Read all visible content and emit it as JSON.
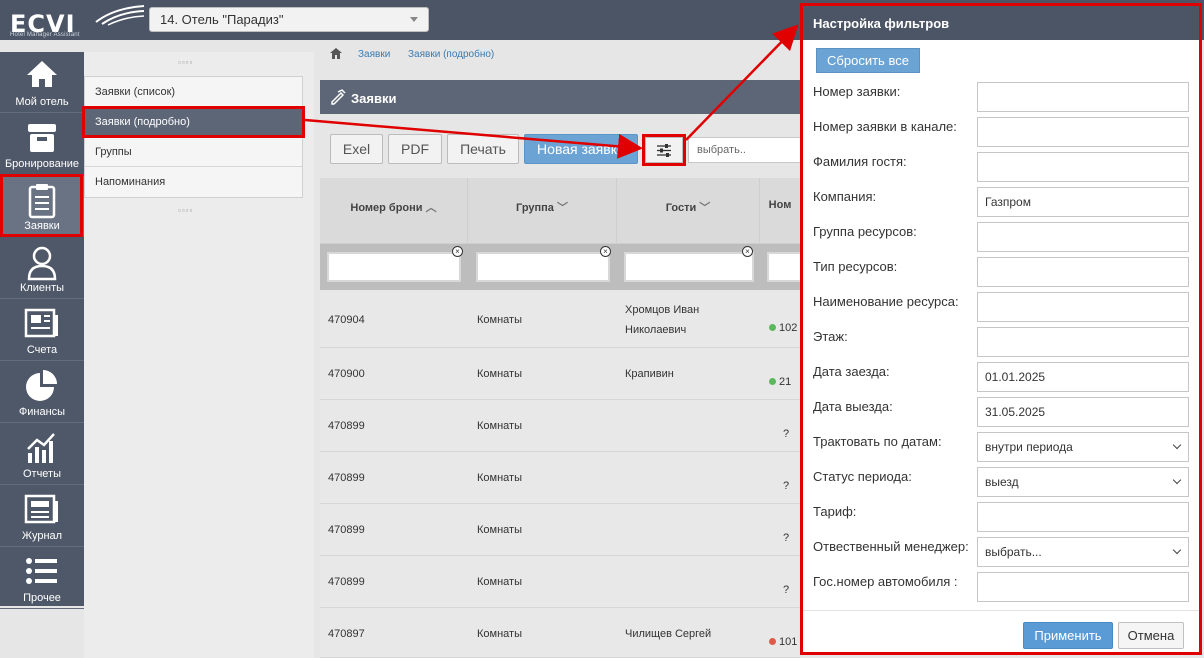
{
  "logo": {
    "text": "ECVI",
    "subtitle": "Hotel Manager Assistant"
  },
  "hotel_select": {
    "value": "14. Отель \"Парадиз\""
  },
  "sidebar": {
    "items": [
      {
        "label": "Мой отель",
        "icon": "home-icon"
      },
      {
        "label": "Бронирование",
        "icon": "box-icon"
      },
      {
        "label": "Заявки",
        "icon": "clipboard-icon"
      },
      {
        "label": "Клиенты",
        "icon": "user-icon"
      },
      {
        "label": "Счета",
        "icon": "invoice-icon"
      },
      {
        "label": "Финансы",
        "icon": "pie-chart-icon"
      },
      {
        "label": "Отчеты",
        "icon": "bar-chart-icon"
      },
      {
        "label": "Журнал",
        "icon": "journal-icon"
      },
      {
        "label": "Прочее",
        "icon": "list-icon"
      }
    ]
  },
  "subnav": {
    "items": [
      "Заявки (список)",
      "Заявки (подробно)",
      "Группы",
      "Напоминания"
    ],
    "handle": "▫▫▫▫"
  },
  "breadcrumb": {
    "home_icon": "home-icon",
    "items": [
      "Заявки",
      "Заявки (подробно)"
    ]
  },
  "panel": {
    "title": "Заявки",
    "icon": "pencil-icon"
  },
  "toolbar": {
    "excel": "Exel",
    "pdf": "PDF",
    "print": "Печать",
    "new_request": "Новая заявка",
    "filter_icon": "sliders-icon",
    "choose_placeholder": "выбрать.."
  },
  "grid": {
    "headers": [
      "Номер брони",
      "Группа",
      "Гости",
      "Ном"
    ],
    "rows": [
      {
        "booking": "470904",
        "group": "Комнаты",
        "guests_1": "Хромцов Иван",
        "guests_2": "Николаевич",
        "status_color": "#5cb85c",
        "num": "102"
      },
      {
        "booking": "470900",
        "group": "Комнаты",
        "guests_1": "Крапивин",
        "guests_2": "",
        "status_color": "#5cb85c",
        "num": "21"
      },
      {
        "booking": "470899",
        "group": "Комнаты",
        "guests_1": "",
        "guests_2": "",
        "status_color": "",
        "num": "?"
      },
      {
        "booking": "470899",
        "group": "Комнаты",
        "guests_1": "",
        "guests_2": "",
        "status_color": "",
        "num": "?"
      },
      {
        "booking": "470899",
        "group": "Комнаты",
        "guests_1": "",
        "guests_2": "",
        "status_color": "",
        "num": "?"
      },
      {
        "booking": "470899",
        "group": "Комнаты",
        "guests_1": "",
        "guests_2": "",
        "status_color": "",
        "num": "?"
      },
      {
        "booking": "470897",
        "group": "Комнаты",
        "guests_1": "Чилищев Сергей",
        "guests_2": "",
        "status_color": "#e05a4a",
        "num": "101"
      }
    ]
  },
  "filters": {
    "title": "Настройка фильтров",
    "reset": "Сбросить все",
    "fields": [
      {
        "label": "Номер заявки:",
        "value": "",
        "type": "input"
      },
      {
        "label": "Номер заявки в канале:",
        "value": "",
        "type": "input"
      },
      {
        "label": "Фамилия гостя:",
        "value": "",
        "type": "input"
      },
      {
        "label": "Компания:",
        "value": "Газпром",
        "type": "input"
      },
      {
        "label": "Группа ресурсов:",
        "value": "",
        "type": "input"
      },
      {
        "label": "Тип ресурсов:",
        "value": "",
        "type": "input"
      },
      {
        "label": "Наименование ресурса:",
        "value": "",
        "type": "input"
      },
      {
        "label": "Этаж:",
        "value": "",
        "type": "input"
      },
      {
        "label": "Дата заезда:",
        "value": "01.01.2025",
        "type": "input"
      },
      {
        "label": "Дата выезда:",
        "value": "31.05.2025",
        "type": "input"
      },
      {
        "label": "Трактовать по датам:",
        "value": "внутри периода",
        "type": "select"
      },
      {
        "label": "Статус периода:",
        "value": "выезд",
        "type": "select"
      },
      {
        "label": "Тариф:",
        "value": "",
        "type": "input"
      },
      {
        "label": "Отвественный менеджер:",
        "value": "выбрать...",
        "type": "select"
      },
      {
        "label": "Гос.номер автомобиля :",
        "value": "",
        "type": "input"
      }
    ],
    "apply": "Применить",
    "cancel": "Отмена"
  },
  "colors": {
    "highlight": "#e00000",
    "accent": "#6ba3d4",
    "sidebar": "#4f5868"
  }
}
